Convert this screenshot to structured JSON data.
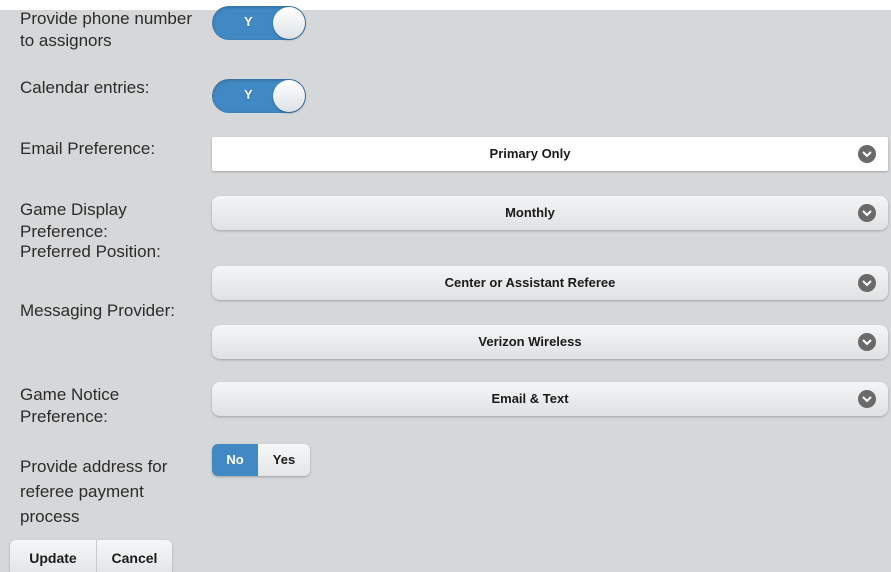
{
  "form": {
    "phone_label": "Provide phone number to assignors",
    "phone_toggle": "Y",
    "calendar_label": "Calendar entries:",
    "calendar_toggle": "Y",
    "email_label": "Email Preference:",
    "email_value": "Primary Only",
    "game_display_label": "Game Display Preference:",
    "game_display_value": "Monthly",
    "position_label": "Preferred Position:",
    "position_value": "Center or Assistant Referee",
    "messaging_label": "Messaging Provider:",
    "messaging_value": "Verizon Wireless",
    "game_notice_label": "Game Notice Preference:",
    "game_notice_value": "Email & Text",
    "address_label": "Provide address for referee payment process",
    "address_no": "No",
    "address_yes": "Yes"
  },
  "actions": {
    "update": "Update",
    "cancel": "Cancel"
  },
  "colors": {
    "accent": "#4189c5",
    "background": "#d5d7d8"
  },
  "icons": {
    "select_chevron": "chevron-down-icon"
  }
}
